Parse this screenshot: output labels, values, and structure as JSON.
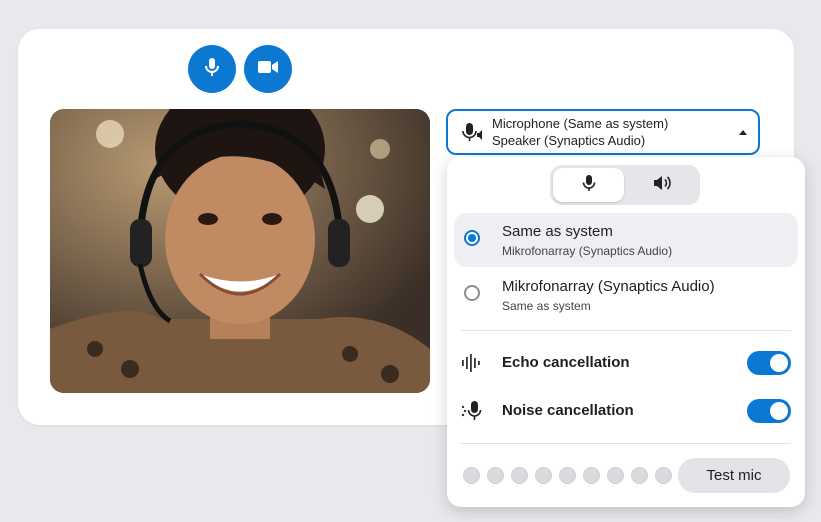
{
  "controls": {
    "mic_icon": "microphone-icon",
    "camera_icon": "video-camera-icon"
  },
  "device_select": {
    "line1": "Microphone (Same as system)",
    "line2": "Speaker (Synaptics Audio)",
    "icon": "mic-speaker-icon",
    "caret": "caret-up-icon"
  },
  "panel": {
    "tabs": [
      {
        "icon": "microphone-icon",
        "active": true
      },
      {
        "icon": "speaker-icon",
        "active": false
      }
    ],
    "devices": [
      {
        "title": "Same as system",
        "subtitle": "Mikrofonarray (Synaptics Audio)",
        "selected": true
      },
      {
        "title": "Mikrofonarray (Synaptics Audio)",
        "subtitle": "Same as system",
        "selected": false
      }
    ],
    "toggles": [
      {
        "label": "Echo cancellation",
        "icon": "echo-waveform-icon",
        "on": true
      },
      {
        "label": "Noise cancellation",
        "icon": "noise-mic-icon",
        "on": true
      }
    ],
    "level_dots": 9,
    "test_button": "Test mic"
  },
  "colors": {
    "accent": "#0b78d1",
    "background": "#e8e9ec"
  }
}
